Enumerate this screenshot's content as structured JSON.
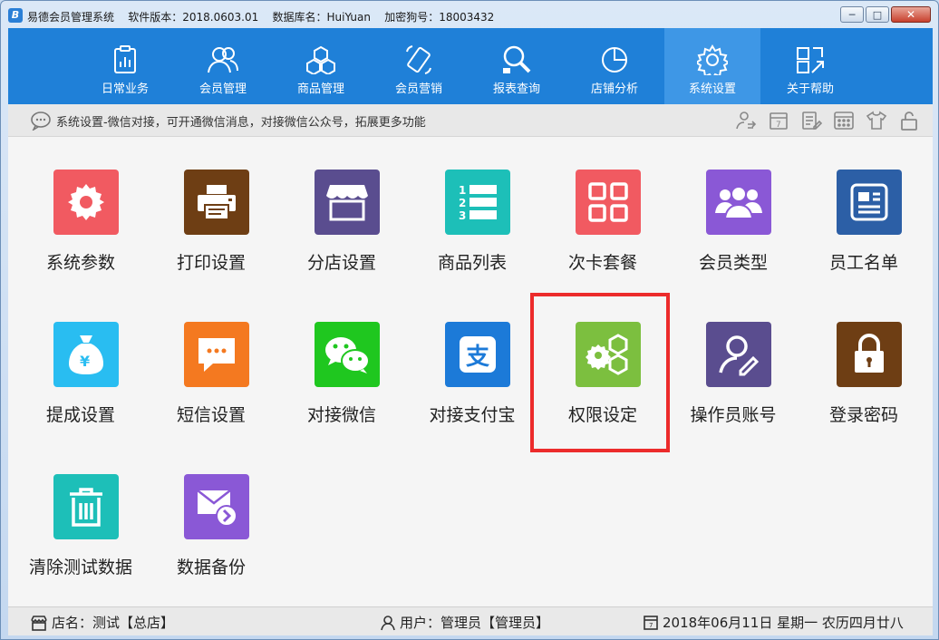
{
  "window": {
    "app_icon_letter": "B",
    "title": "易德会员管理系统    软件版本：2018.0603.01    数据库名：HuiYuan    加密狗号：18003432"
  },
  "nav": {
    "items": [
      {
        "label": "日常业务",
        "icon": "clipboard-chart-icon"
      },
      {
        "label": "会员管理",
        "icon": "members-icon"
      },
      {
        "label": "商品管理",
        "icon": "cubes-icon"
      },
      {
        "label": "会员营销",
        "icon": "phone-icon"
      },
      {
        "label": "报表查询",
        "icon": "search-report-icon"
      },
      {
        "label": "店铺分析",
        "icon": "pie-chart-icon"
      },
      {
        "label": "系统设置",
        "icon": "gear-icon",
        "active": true
      },
      {
        "label": "关于帮助",
        "icon": "help-icon"
      }
    ]
  },
  "infobar": {
    "text": "系统设置-微信对接，可开通微信消息，对接微信公众号，拓展更多功能"
  },
  "tiles": [
    {
      "label": "系统参数",
      "color": "#f15a61",
      "icon": "gear-icon"
    },
    {
      "label": "打印设置",
      "color": "#6e3e14",
      "icon": "printer-icon"
    },
    {
      "label": "分店设置",
      "color": "#5a4d8f",
      "icon": "store-icon"
    },
    {
      "label": "商品列表",
      "color": "#1dbfb8",
      "icon": "numbered-list-icon"
    },
    {
      "label": "次卡套餐",
      "color": "#f15a61",
      "icon": "grid-icon"
    },
    {
      "label": "会员类型",
      "color": "#8a58d6",
      "icon": "user-group-icon"
    },
    {
      "label": "员工名单",
      "color": "#2c5fa6",
      "icon": "id-card-icon"
    },
    {
      "label": "提成设置",
      "color": "#29bdf1",
      "icon": "money-bag-icon"
    },
    {
      "label": "短信设置",
      "color": "#f47920",
      "icon": "message-icon"
    },
    {
      "label": "对接微信",
      "color": "#1fc71f",
      "icon": "wechat-icon"
    },
    {
      "label": "对接支付宝",
      "color": "#1c7ad8",
      "icon": "alipay-icon"
    },
    {
      "label": "权限设定",
      "color": "#7cbf3f",
      "icon": "gears-icon"
    },
    {
      "label": "操作员账号",
      "color": "#5a4d8f",
      "icon": "user-edit-icon"
    },
    {
      "label": "登录密码",
      "color": "#6e3e14",
      "icon": "lock-icon"
    },
    {
      "label": "清除测试数据",
      "color": "#1dbfb8",
      "icon": "trash-icon"
    },
    {
      "label": "数据备份",
      "color": "#8a58d6",
      "icon": "mail-forward-icon"
    }
  ],
  "status": {
    "store": "店名：测试【总店】",
    "user": "用户：管理员【管理员】",
    "date": "2018年06月11日 星期一 农历四月廿八"
  }
}
